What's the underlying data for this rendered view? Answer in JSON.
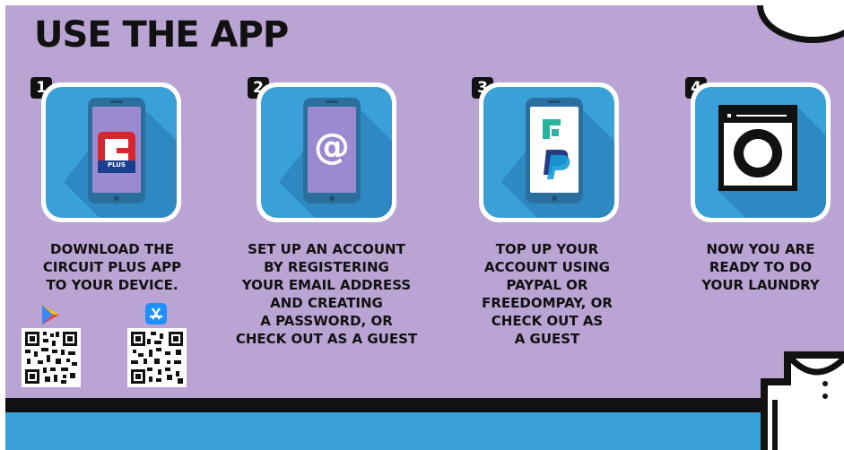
{
  "title": "USE THE APP",
  "steps": [
    {
      "number": "1",
      "lines": [
        "DOWNLOAD THE",
        "CIRCUIT PLUS APP",
        "TO YOUR DEVICE."
      ],
      "icon": "circuit-plus-logo-icon",
      "logo_text": "PLUS"
    },
    {
      "number": "2",
      "lines": [
        "SET UP AN ACCOUNT",
        "BY REGISTERING",
        "YOUR EMAIL ADDRESS",
        "AND CREATING",
        "A PASSWORD, OR",
        "CHECK OUT AS A GUEST"
      ],
      "icon": "at-sign-icon",
      "glyph": "@"
    },
    {
      "number": "3",
      "lines": [
        "TOP UP YOUR",
        "ACCOUNT USING",
        "PAYPAL OR",
        "FREEDOMPAY, OR",
        "CHECK OUT AS",
        "A GUEST"
      ],
      "icon": "payment-logos-icon"
    },
    {
      "number": "4",
      "lines": [
        "NOW YOU ARE",
        "READY TO DO",
        "YOUR LAUNDRY"
      ],
      "icon": "washing-machine-icon"
    }
  ],
  "stores": [
    {
      "name": "google-play-icon"
    },
    {
      "name": "app-store-icon"
    }
  ],
  "colors": {
    "background": "#b9a4d4",
    "tile_blue": "#3aa0d8",
    "phone_body": "#2a7ab0",
    "phone_screen": "#9b8ad0",
    "dark": "#111111",
    "brand_red": "#d7262d"
  }
}
